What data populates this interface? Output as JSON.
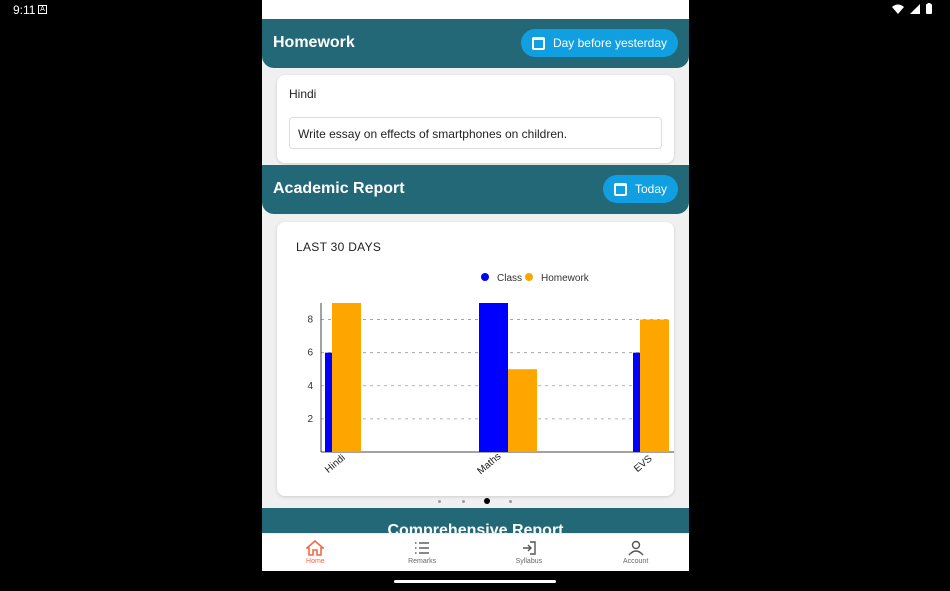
{
  "status_bar": {
    "time": "9:11",
    "notif_glyph": "A"
  },
  "homework": {
    "title": "Homework",
    "date_label": "Day before yesterday",
    "subject": "Hindi",
    "task": "Write essay on effects of smartphones on children."
  },
  "academic": {
    "title": "Academic Report",
    "date_label": "Today",
    "period_label": "LAST 30 DAYS"
  },
  "chart_data": {
    "type": "bar",
    "categories": [
      "Hindi",
      "Maths",
      "EVS"
    ],
    "series": [
      {
        "name": "Class",
        "values": [
          6,
          9,
          6
        ],
        "color": "#0000ff"
      },
      {
        "name": "Homework",
        "values": [
          9,
          5,
          8
        ],
        "color": "#ffa500"
      }
    ],
    "yticks": [
      2,
      4,
      6,
      8
    ],
    "ylim": [
      0,
      9
    ],
    "grid": true,
    "legend": "top-center"
  },
  "comprehensive": {
    "title": "Comprehensive Report"
  },
  "bottom_nav": [
    {
      "label": "Home",
      "icon": "home-icon",
      "active": true
    },
    {
      "label": "Remarks",
      "icon": "list-icon",
      "active": false
    },
    {
      "label": "Syllabus",
      "icon": "login-icon",
      "active": false
    },
    {
      "label": "Account",
      "icon": "person-icon",
      "active": false
    }
  ],
  "colors": {
    "header": "#236877",
    "pill": "#109fe0",
    "active_nav": "#ef6a4a"
  }
}
